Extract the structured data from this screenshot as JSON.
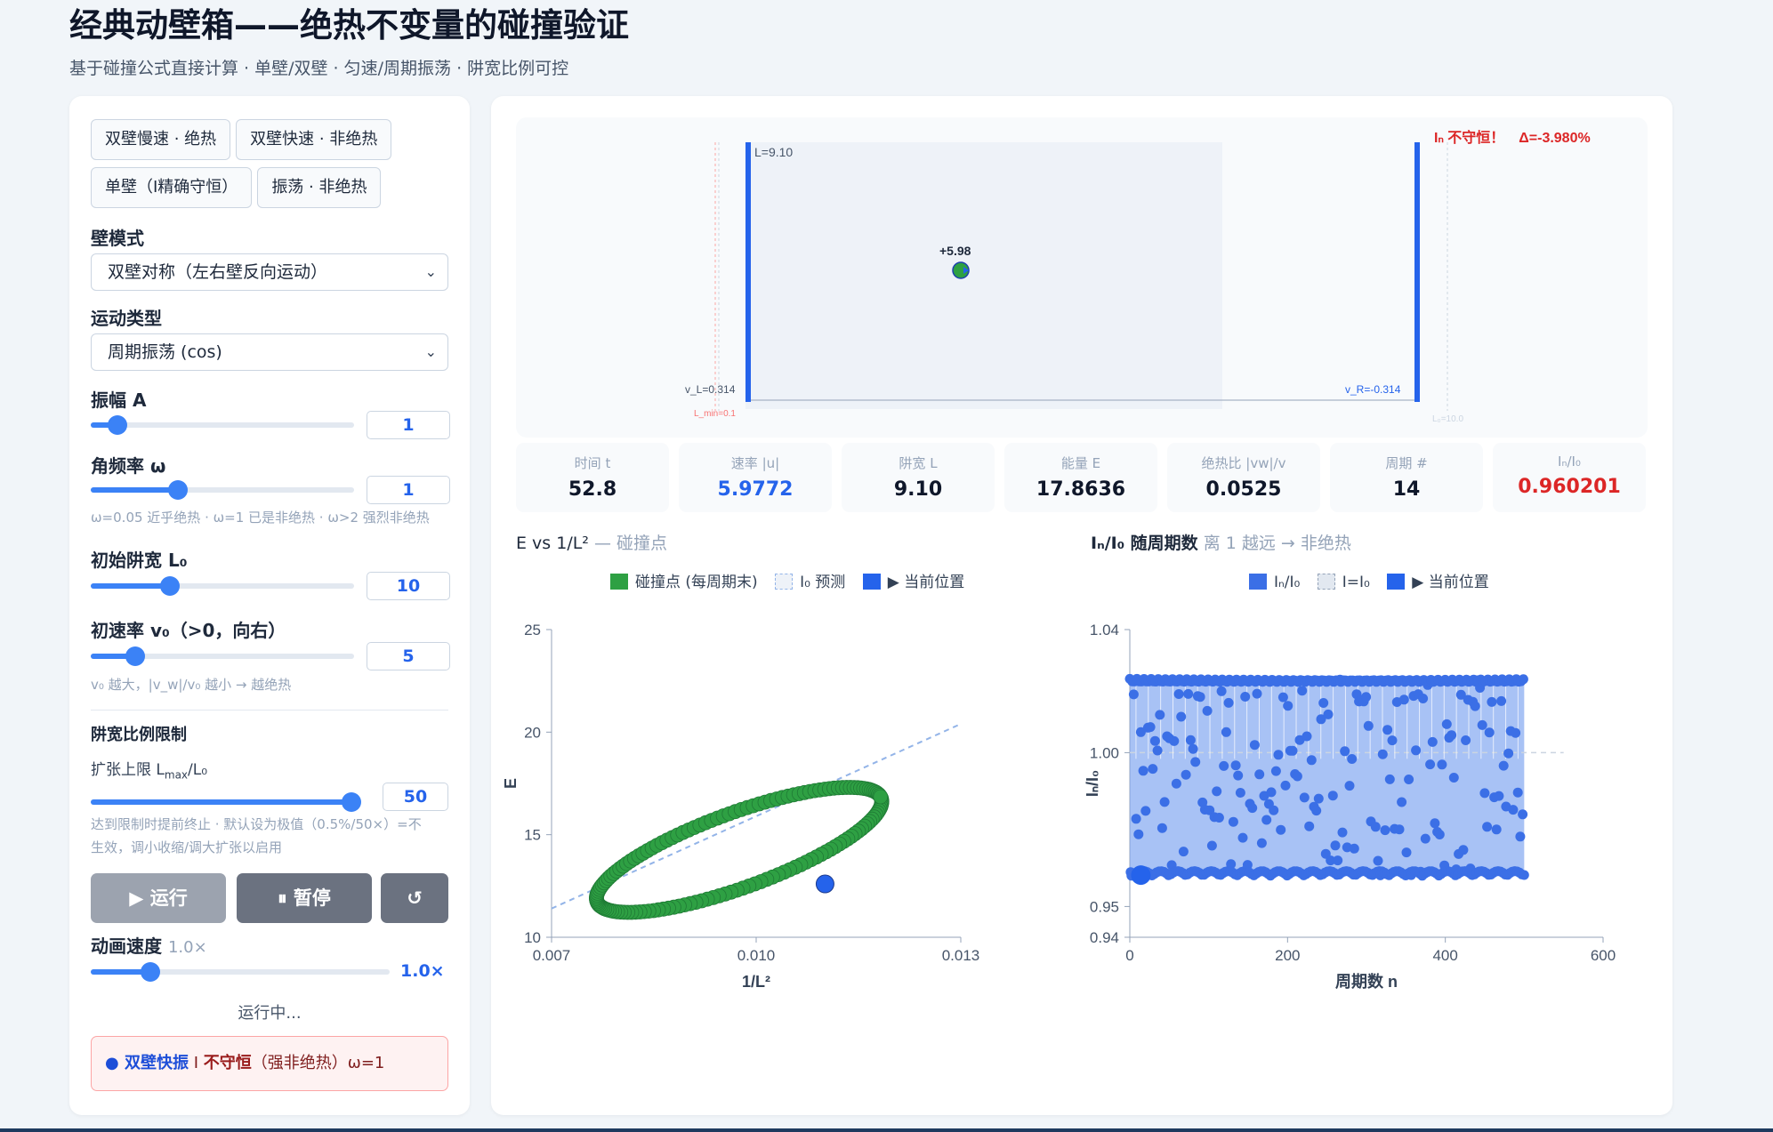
{
  "header": {
    "title": "经典动壁箱——绝热不变量的碰撞验证",
    "subtitle": "基于碰撞公式直接计算 · 单壁/双壁 · 匀速/周期振荡 · 阱宽比例可控"
  },
  "presets": [
    "双壁慢速 · 绝热",
    "双壁快速 · 非绝热",
    "单壁（I精确守恒）",
    "振荡 · 非绝热"
  ],
  "controls": {
    "wall_mode_label": "壁模式",
    "wall_mode_value": "双壁对称（左右壁反向运动）",
    "motion_type_label": "运动类型",
    "motion_type_value": "周期振荡 (cos)",
    "amplitude": {
      "label": "振幅 A",
      "value": "1",
      "fraction": 0.1
    },
    "omega": {
      "label": "角频率 ω",
      "value": "1",
      "fraction": 0.33,
      "hint": "ω=0.05 近乎绝热 · ω=1 已是非绝热 · ω>2 强烈非绝热"
    },
    "L0": {
      "label": "初始阱宽 L₀",
      "value": "10",
      "fraction": 0.3
    },
    "v0": {
      "label": "初速率 v₀（>0，向右）",
      "value": "5",
      "fraction": 0.17,
      "hint": "v₀ 越大，|v_w|/v₀ 越小 → 越绝热"
    },
    "ratio_title": "阱宽比例限制",
    "expand_label_main": "扩张上限 L",
    "expand_label_sub": "max",
    "expand_label_tail": "/L₀",
    "expand": {
      "value": "50",
      "fraction": 1.0
    },
    "expand_hint": [
      "达到限制时提前终止 · 默认设为极值（0.5%/50×）=不",
      "生效，调小收缩/调大扩张以启用"
    ],
    "speed_label": "动画速度",
    "speed_sub": "1.0×",
    "speed_value": "1.0×",
    "speed_fraction": 0.2
  },
  "buttons": {
    "run": "▶ 运行",
    "pause": "⏸ 暂停",
    "reset": "↺"
  },
  "status": "运行中...",
  "verdict": {
    "part1": "● 双壁快振",
    "part2": " I ",
    "part3": "不守恒",
    "part4": "（强非绝热）ω=1"
  },
  "sim": {
    "warning": "Iₙ 不守恒！　Δ=-3.980%",
    "width_label": "L=9.10",
    "particle_label": "+5.98",
    "vl_label": "v_L=0.314",
    "vr_label": "v_R=-0.314",
    "lmin_label": "L_min=0.1",
    "lmax_label": "L₀=10.0"
  },
  "stats": [
    {
      "label": "时间 t",
      "value": "52.8",
      "style": ""
    },
    {
      "label": "速率 |u|",
      "value": "5.9772",
      "style": "blue"
    },
    {
      "label": "阱宽 L",
      "value": "9.10",
      "style": ""
    },
    {
      "label": "能量 E",
      "value": "17.8636",
      "style": ""
    },
    {
      "label": "绝热比 |vw|/v",
      "value": "0.0525",
      "style": ""
    },
    {
      "label": "周期 #",
      "value": "14",
      "style": ""
    },
    {
      "label": "Iₙ/I₀",
      "value": "0.960201",
      "style": "red"
    }
  ],
  "chart_e": {
    "title_main": "E vs 1/L²",
    "title_sub": " — 碰撞点",
    "legend": [
      "碰撞点 (每周期末)",
      "I₀ 预测",
      "▶ 当前位置"
    ],
    "colors": {
      "points": "#2ea043",
      "pred": "#93b4e8",
      "current": "#2563eb"
    }
  },
  "chart_i": {
    "title_main": "Iₙ/I₀ 随周期数",
    "title_sub": " 离 1 越远 → 非绝热",
    "legend": [
      "Iₙ/I₀",
      "I=I₀",
      "▶ 当前位置"
    ],
    "colors": {
      "points": "#3b6fe6",
      "ref": "#cbd5e1",
      "current": "#2563eb"
    }
  },
  "chart_data": [
    {
      "type": "scatter",
      "xlabel": "1/L²",
      "ylabel": "E",
      "xlim": [
        0.007,
        0.013
      ],
      "ylim": [
        10,
        25
      ],
      "xticks": [
        "0.007",
        "0.010",
        "0.013"
      ],
      "yticks": [
        "10",
        "15",
        "20",
        "25"
      ],
      "series": [
        {
          "name": "碰撞点 (每周期末)",
          "shape": "ellipse",
          "center": [
            0.00975,
            14.26
          ],
          "semi_x": 0.00227,
          "semi_y": 3.6,
          "tilt_deg": 40,
          "count": 150
        },
        {
          "name": "I₀ 预测",
          "line": [
            [
              0.007,
              11.4
            ],
            [
              0.013,
              20.4
            ]
          ]
        },
        {
          "name": "▶ 当前位置",
          "points": [
            [
              0.01101,
              12.6
            ]
          ]
        }
      ]
    },
    {
      "type": "scatter",
      "xlabel": "周期数 n",
      "ylabel": "Iₙ/I₀",
      "xlim": [
        0,
        600
      ],
      "ylim": [
        0.94,
        1.04
      ],
      "xticks": [
        "0",
        "200",
        "400",
        "600"
      ],
      "yticks": [
        "0.94",
        "0.95",
        "1.00",
        "1.04"
      ],
      "series": [
        {
          "name": "Iₙ/I₀",
          "n_range": [
            0,
            500
          ],
          "band": [
            0.96,
            1.024
          ],
          "count": 500
        },
        {
          "name": "I=I₀",
          "line": [
            [
              0,
              1.0
            ],
            [
              550,
              1.0
            ]
          ]
        },
        {
          "name": "▶ 当前位置",
          "points": [
            [
              14,
              0.9602
            ]
          ]
        }
      ]
    }
  ]
}
